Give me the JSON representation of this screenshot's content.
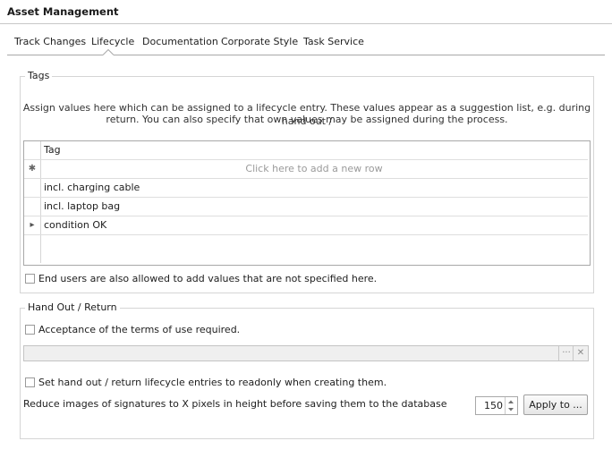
{
  "window": {
    "title": "Asset Management"
  },
  "tabs": [
    {
      "label": "Track Changes"
    },
    {
      "label": "Lifecycle"
    },
    {
      "label": "Documentation"
    },
    {
      "label": "Corporate Style"
    },
    {
      "label": "Task Service"
    }
  ],
  "active_tab": "Lifecycle",
  "tags_group": {
    "label": "Tags",
    "description_line1": "Assign values here which can be assigned to a lifecycle entry. These values appear as a suggestion list, e.g. during hand out /",
    "description_line2": "return. You can also specify that own values may be assigned during the process.",
    "grid": {
      "column_header": "Tag",
      "new_row_glyph": "✱",
      "new_row_placeholder": "Click here to add a new row",
      "current_row_glyph": "▸",
      "rows": [
        {
          "value": "incl. charging cable"
        },
        {
          "value": "incl. laptop bag"
        },
        {
          "value": "condition OK"
        }
      ]
    },
    "allow_custom_values": {
      "label": "End users are also allowed to add values that are not specified here.",
      "checked": false
    }
  },
  "handout_group": {
    "label": "Hand Out / Return",
    "terms_required": {
      "label": "Acceptance of the terms of use required.",
      "checked": false
    },
    "terms_field": {
      "value": "",
      "browse_glyph": "···",
      "clear_glyph": "✕"
    },
    "readonly_entries": {
      "label": "Set hand out / return lifecycle entries to readonly when creating them.",
      "checked": false
    },
    "signature_height_label": "Reduce images of signatures to X pixels in height before saving them to the database",
    "signature_height_value": "150",
    "apply_button": "Apply to ..."
  },
  "colors": {
    "border": "#d5d5d5",
    "grid_border": "#a8a8a8",
    "placeholder_text": "#9a9a9a",
    "disabled_field": "#efefef"
  }
}
